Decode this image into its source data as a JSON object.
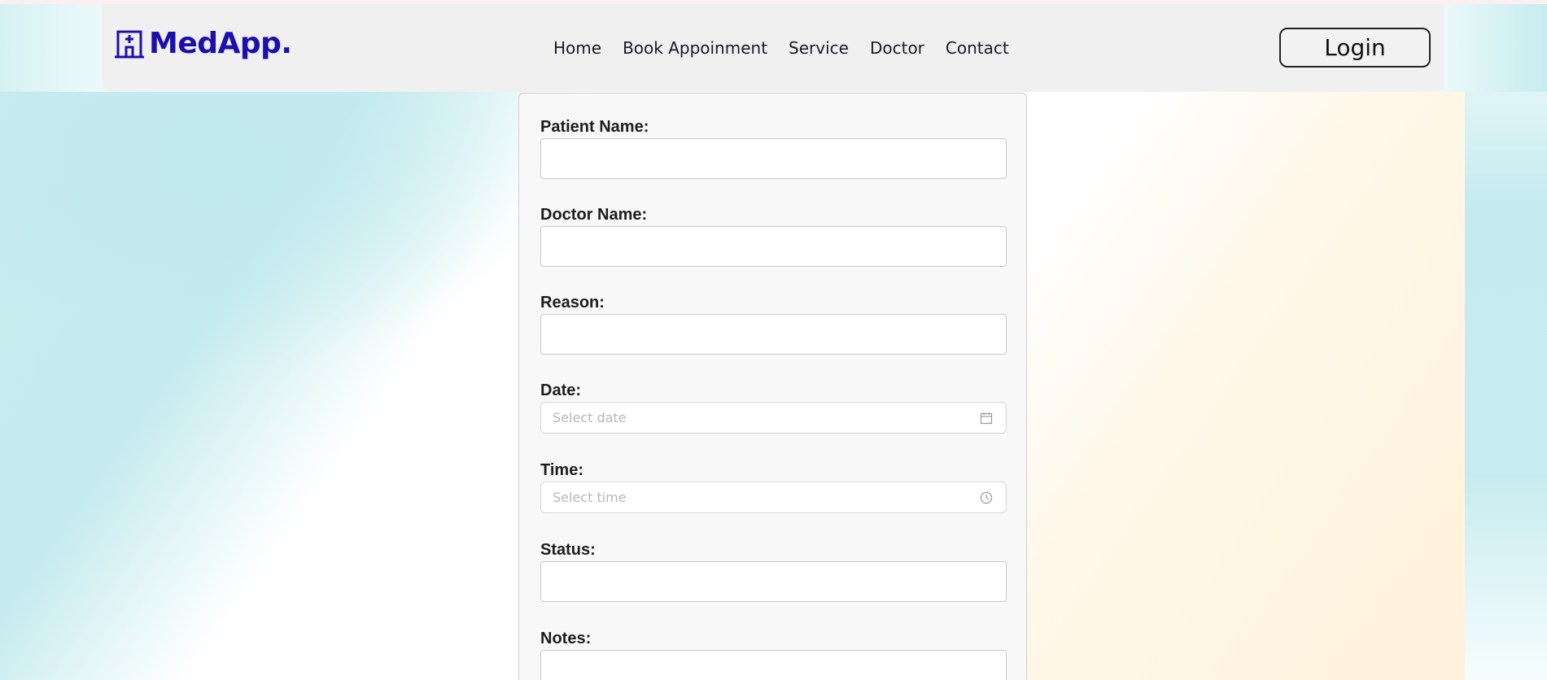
{
  "brand": {
    "name": "MedApp.",
    "logo_icon": "hospital-icon",
    "color": "#1b0fb0"
  },
  "nav": {
    "links": [
      "Home",
      "Book Appoinment",
      "Service",
      "Doctor",
      "Contact"
    ],
    "login_label": "Login"
  },
  "form": {
    "patient_name": {
      "label": "Patient Name:",
      "value": ""
    },
    "doctor_name": {
      "label": "Doctor Name:",
      "value": ""
    },
    "reason": {
      "label": "Reason:",
      "value": ""
    },
    "date": {
      "label": "Date:",
      "placeholder": "Select date",
      "icon": "calendar-icon"
    },
    "time": {
      "label": "Time:",
      "placeholder": "Select time",
      "icon": "clock-icon"
    },
    "status": {
      "label": "Status:",
      "value": ""
    },
    "notes": {
      "label": "Notes:",
      "value": ""
    }
  }
}
